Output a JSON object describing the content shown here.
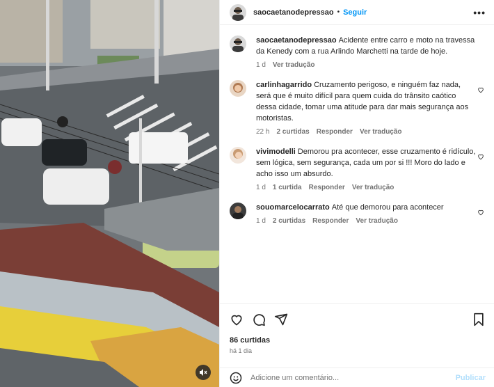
{
  "post": {
    "username": "saocaetanodepressao",
    "follow_label": "Seguir",
    "separator": "•",
    "more_label": "•••",
    "caption": "Acidente entre carro e moto na travessa da Kenedy com a rua Arlindo Marchetti na tarde de hoje.",
    "caption_time": "1 d",
    "translate_label": "Ver tradução"
  },
  "comments": [
    {
      "username": "carlinhagarrido",
      "text": "Cruzamento perigoso, e ninguém faz nada, será que é muito difícil para quem cuida do trânsito caótico dessa cidade, tomar uma atitude para dar mais segurança aos motoristas.",
      "time": "22 h",
      "likes": "2 curtidas",
      "reply": "Responder",
      "translate": "Ver tradução"
    },
    {
      "username": "vivimodelli",
      "text": "Demorou pra acontecer, esse cruzamento é ridículo, sem lógica, sem segurança, cada um por si !!! Moro do lado e acho isso um absurdo.",
      "time": "1 d",
      "likes": "1 curtida",
      "reply": "Responder",
      "translate": "Ver tradução"
    },
    {
      "username": "souomarcelocarrato",
      "text": "Até que demorou para acontecer",
      "time": "1 d",
      "likes": "2 curtidas",
      "reply": "Responder",
      "translate": "Ver tradução"
    }
  ],
  "footer": {
    "likes_count": "86 curtidas",
    "posted_ago": "há 1 dia",
    "comment_placeholder": "Adicione um comentário...",
    "publish_label": "Publicar"
  },
  "icons": {
    "like": "heart-icon",
    "comment": "comment-icon",
    "share": "share-icon",
    "save": "bookmark-icon",
    "emoji": "emoji-icon",
    "mute": "speaker-muted-icon",
    "more": "more-options-icon"
  },
  "colors": {
    "link_blue": "#0095f6",
    "publish_disabled": "#b2dffc",
    "muted_text": "#737373"
  }
}
